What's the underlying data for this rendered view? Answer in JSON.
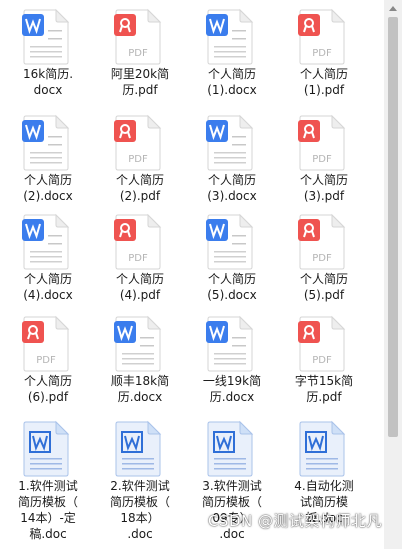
{
  "colors": {
    "word": "#3b7ded",
    "pdf": "#ef5350",
    "doc_page": "#e9f0fb",
    "doc_icon": "#2f6fd7"
  },
  "files": [
    {
      "name": "16k简历.\ndocx",
      "kind": "word"
    },
    {
      "name": "阿里20k简\n历.pdf",
      "kind": "pdf"
    },
    {
      "name": "个人简历\n(1).docx",
      "kind": "word"
    },
    {
      "name": "个人简历\n(1).pdf",
      "kind": "pdf"
    },
    {
      "name": "个人简历\n(2).docx",
      "kind": "word"
    },
    {
      "name": "个人简历\n(2).pdf",
      "kind": "pdf"
    },
    {
      "name": "个人简历\n(3).docx",
      "kind": "word"
    },
    {
      "name": "个人简历\n(3).pdf",
      "kind": "pdf"
    },
    {
      "name": "个人简历\n(4).docx",
      "kind": "word"
    },
    {
      "name": "个人简历\n(4).pdf",
      "kind": "pdf"
    },
    {
      "name": "个人简历\n(5).docx",
      "kind": "word"
    },
    {
      "name": "个人简历\n(5).pdf",
      "kind": "pdf"
    },
    {
      "name": "个人简历\n(6).pdf",
      "kind": "pdf"
    },
    {
      "name": "顺丰18k简\n历.docx",
      "kind": "word"
    },
    {
      "name": "一线19k简\n历.docx",
      "kind": "word"
    },
    {
      "name": "字节15k简\n历.pdf",
      "kind": "pdf"
    },
    {
      "name": "1.软件测试\n简历模板（\n14本）-定\n稿.doc",
      "kind": "doc"
    },
    {
      "name": "2.软件测试\n简历模板（\n18本）\n.doc",
      "kind": "doc"
    },
    {
      "name": "3.软件测试\n简历模板（\n09专）\n.doc",
      "kind": "doc"
    },
    {
      "name": "4.自动化测\n试简历模\n板.doc",
      "kind": "doc"
    }
  ],
  "icon_glyphs": {
    "pdf_text": "PDF"
  },
  "watermark": "CSDN @测试架构师北凡"
}
